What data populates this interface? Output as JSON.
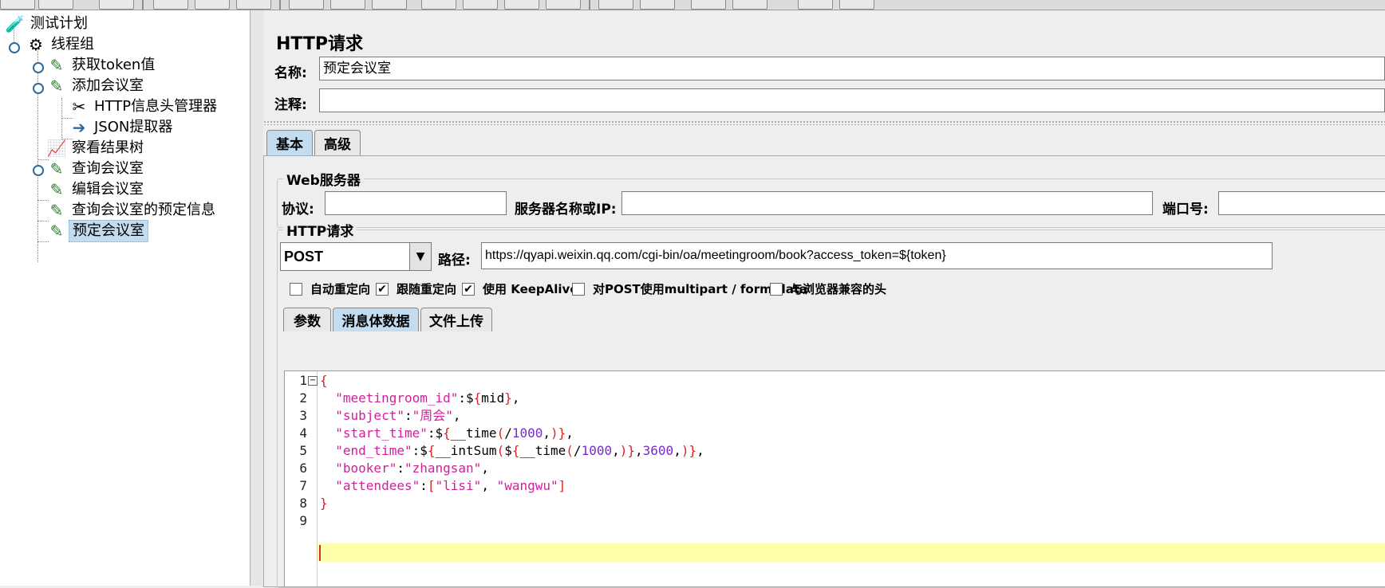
{
  "tree": {
    "items": [
      {
        "label": "测试计划",
        "icon": "flask-icon"
      },
      {
        "label": "线程组",
        "icon": "gear-icon"
      },
      {
        "label": "获取token值",
        "icon": "pipette-icon"
      },
      {
        "label": "添加会议室",
        "icon": "pipette-icon"
      },
      {
        "label": "HTTP信息头管理器",
        "icon": "wrench-icon"
      },
      {
        "label": "JSON提取器",
        "icon": "extractor-icon"
      },
      {
        "label": "察看结果树",
        "icon": "chart-icon"
      },
      {
        "label": "查询会议室",
        "icon": "pipette-icon"
      },
      {
        "label": "编辑会议室",
        "icon": "pipette-icon"
      },
      {
        "label": "查询会议室的预定信息",
        "icon": "pipette-icon"
      },
      {
        "label": "预定会议室",
        "icon": "pipette-icon"
      }
    ]
  },
  "panel": {
    "title": "HTTP请求",
    "name_label": "名称:",
    "name_value": "预定会议室",
    "comment_label": "注释:",
    "comment_value": ""
  },
  "tabs": [
    "基本",
    "高级"
  ],
  "server": {
    "group_title": "Web服务器",
    "protocol_label": "协议:",
    "protocol_value": "",
    "host_label": "服务器名称或IP:",
    "host_value": "",
    "port_label": "端口号:",
    "port_value": ""
  },
  "request": {
    "group_title": "HTTP请求",
    "method": "POST",
    "path_label": "路径:",
    "path_value": "https://qyapi.weixin.qq.com/cgi-bin/oa/meetingroom/book?access_token=${token}",
    "options": [
      {
        "label": "自动重定向",
        "checked": false
      },
      {
        "label": "跟随重定向",
        "checked": true
      },
      {
        "label": "使用 KeepAlive",
        "checked": true
      },
      {
        "label": "对POST使用multipart / form-data",
        "checked": false
      },
      {
        "label": "与浏览器兼容的头",
        "checked": false
      }
    ],
    "subtabs": [
      "参数",
      "消息体数据",
      "文件上传"
    ]
  },
  "body": {
    "line_numbers": [
      "1",
      "2",
      "3",
      "4",
      "5",
      "6",
      "7",
      "8",
      "9"
    ],
    "lines": [
      "{",
      "  \"meetingroom_id\":${mid},",
      "  \"subject\":\"周会\",",
      "  \"start_time\":${__time(/1000,)},",
      "  \"end_time\":${__intSum(${__time(/1000,)},3600,)},",
      "  \"booker\":\"zhangsan\",",
      "  \"attendees\":[\"lisi\", \"wangwu\"]",
      "}",
      ""
    ]
  },
  "colors": {
    "selection": "#c4dcf0",
    "current_line": "#ffffaa",
    "string": "#d0209a",
    "brace": "#e02020",
    "number": "#7a2ad0"
  }
}
